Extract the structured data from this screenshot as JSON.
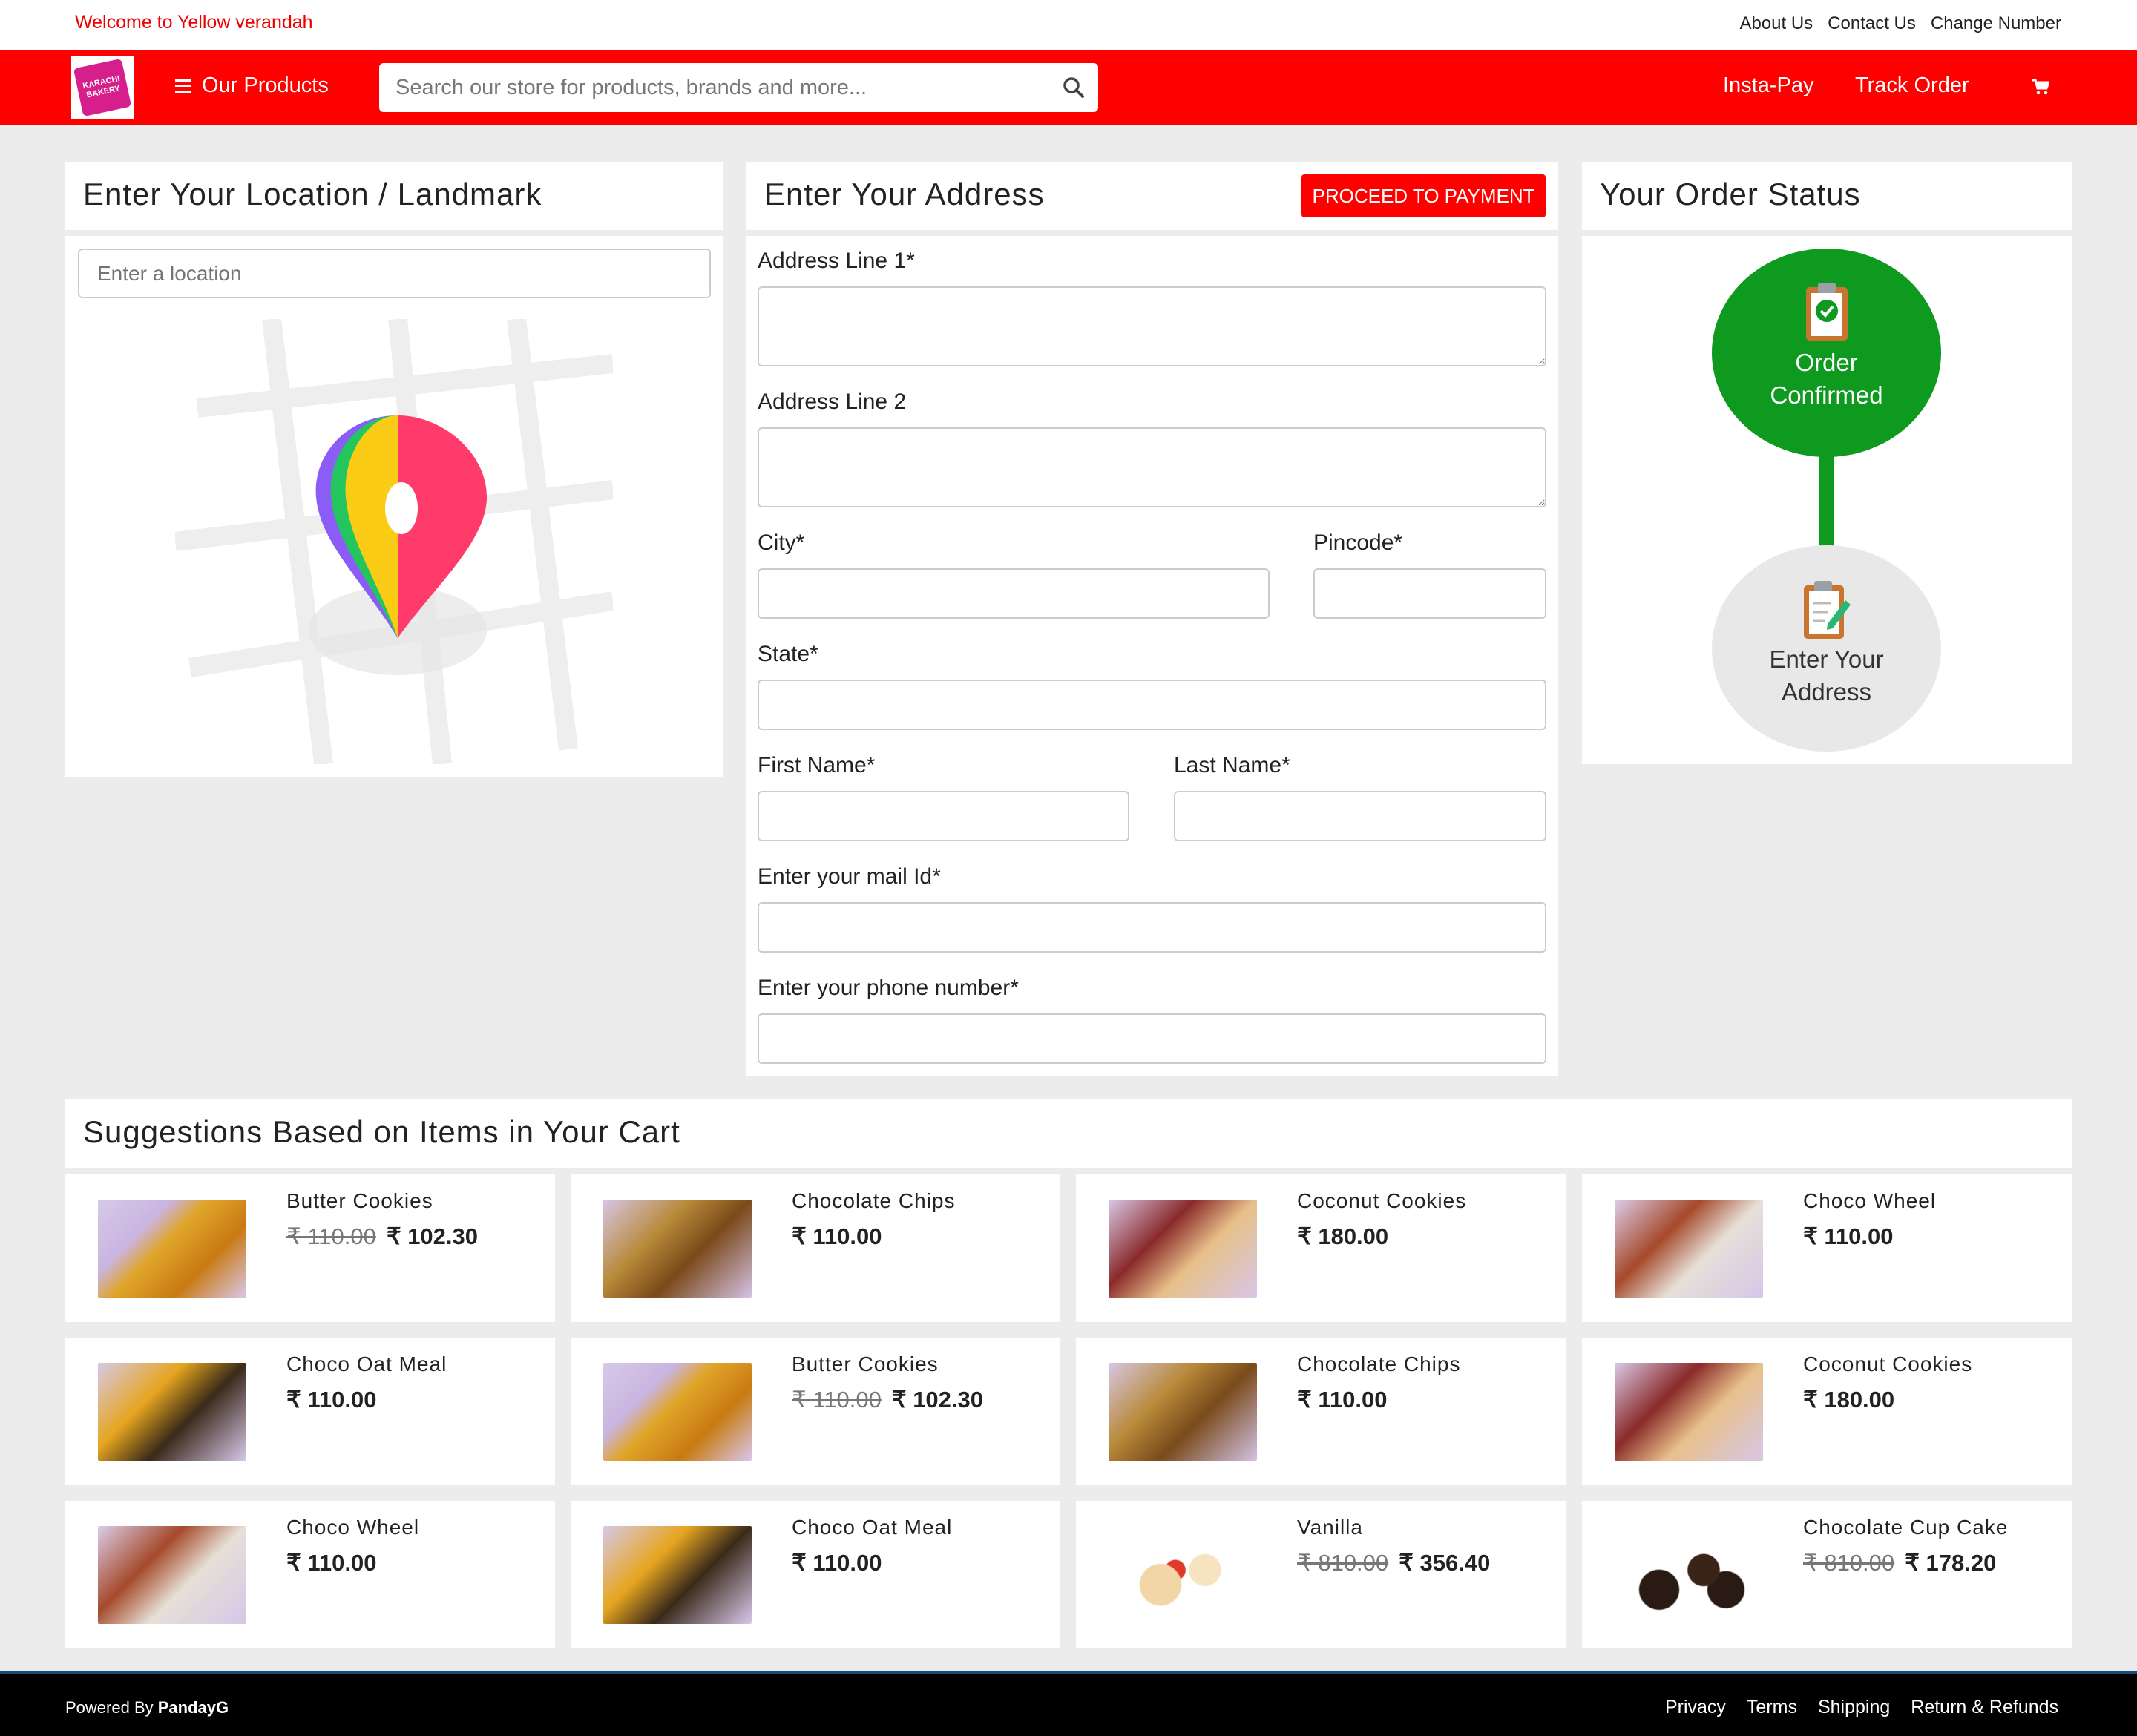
{
  "topbar": {
    "welcome": "Welcome to Yellow verandah",
    "links": [
      "About Us",
      "Contact Us",
      "Change Number"
    ]
  },
  "navbar": {
    "logo_text": "KARACHI BAKERY",
    "products_label": "Our Products",
    "search_placeholder": "Search our store for products, brands and more...",
    "instapay": "Insta-Pay",
    "track_order": "Track Order",
    "bg_color": "#ff0000"
  },
  "location": {
    "title": "Enter Your Location / Landmark",
    "placeholder": "Enter a location"
  },
  "address": {
    "title": "Enter Your Address",
    "proceed_label": "PROCEED TO PAYMENT",
    "address1_label": "Address Line 1*",
    "address2_label": "Address Line 2",
    "city_label": "City*",
    "pincode_label": "Pincode*",
    "state_label": "State*",
    "first_name_label": "First Name*",
    "last_name_label": "Last Name*",
    "mail_label": "Enter your mail Id*",
    "phone_label": "Enter your phone number*"
  },
  "order_status": {
    "title": "Your Order Status",
    "step1": "Order Confirmed",
    "step2": "Enter Your Address",
    "confirmed_color": "#0d9a1f"
  },
  "suggestions": {
    "title": "Suggestions Based on Items in Your Cart",
    "items": [
      {
        "name": "Butter Cookies",
        "old_price": "₹ 110.00",
        "price": "₹ 102.30"
      },
      {
        "name": "Chocolate Chips",
        "old_price": "",
        "price": "₹ 110.00"
      },
      {
        "name": "Coconut Cookies",
        "old_price": "",
        "price": "₹ 180.00"
      },
      {
        "name": "Choco Wheel",
        "old_price": "",
        "price": "₹ 110.00"
      },
      {
        "name": "Choco Oat Meal",
        "old_price": "",
        "price": "₹ 110.00"
      },
      {
        "name": "Butter Cookies",
        "old_price": "₹ 110.00",
        "price": "₹ 102.30"
      },
      {
        "name": "Chocolate Chips",
        "old_price": "",
        "price": "₹ 110.00"
      },
      {
        "name": "Coconut Cookies",
        "old_price": "",
        "price": "₹ 180.00"
      },
      {
        "name": "Choco Wheel",
        "old_price": "",
        "price": "₹ 110.00"
      },
      {
        "name": "Choco Oat Meal",
        "old_price": "",
        "price": "₹ 110.00"
      },
      {
        "name": "Vanilla",
        "old_price": "₹ 810.00",
        "price": "₹ 356.40"
      },
      {
        "name": "Chocolate Cup Cake",
        "old_price": "₹ 810.00",
        "price": "₹ 178.20"
      }
    ]
  },
  "footer": {
    "powered_prefix": "Powered By",
    "powered_brand": "PandayG",
    "links": [
      "Privacy",
      "Terms",
      "Shipping",
      "Return & Refunds"
    ]
  }
}
